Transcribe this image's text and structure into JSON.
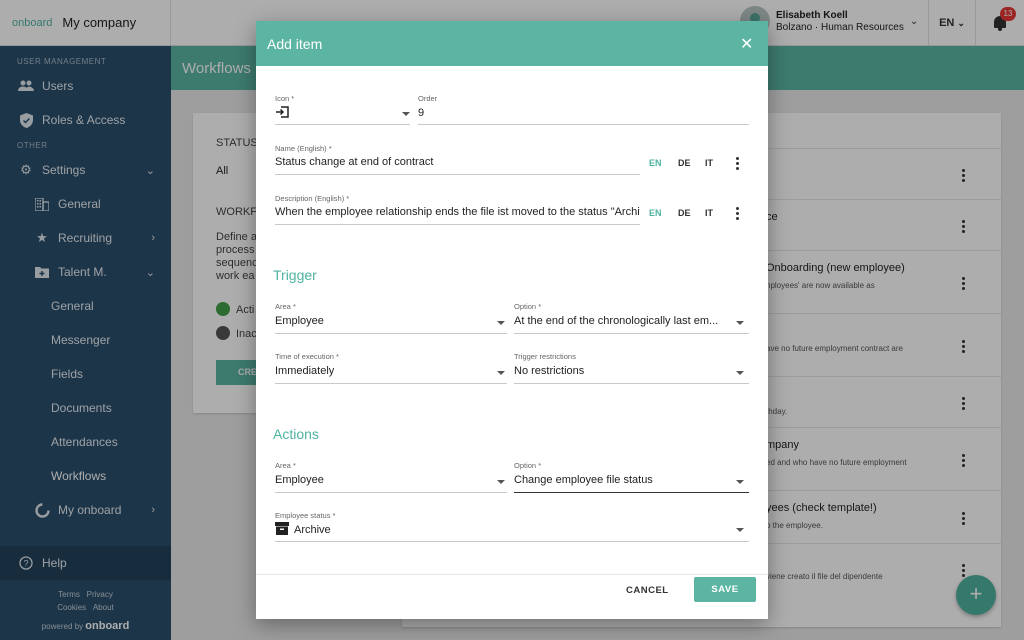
{
  "topbar": {
    "logo": "onboard",
    "company": "My company",
    "user_name": "Elisabeth Koell",
    "user_sub": "Bolzano · Human Resources",
    "lang": "EN",
    "notifications": "13"
  },
  "sidebar": {
    "section_user_management": "USER MANAGEMENT",
    "users": "Users",
    "roles": "Roles & Access",
    "section_other": "OTHER",
    "settings": "Settings",
    "general": "General",
    "recruiting": "Recruiting",
    "talent": "Talent M.",
    "talent_general": "General",
    "messenger": "Messenger",
    "fields": "Fields",
    "documents": "Documents",
    "attendances": "Attendances",
    "workflows": "Workflows",
    "my_onboard": "My onboard",
    "help": "Help",
    "terms": "Terms",
    "privacy": "Privacy",
    "cookies": "Cookies",
    "about": "About",
    "powered_by": "powered by",
    "powered_brand": "onboard"
  },
  "page": {
    "title": "Workflows",
    "status_label": "STATUS",
    "status_value": "All",
    "workflow_label": "WORKFL",
    "define_lines": [
      "Define a",
      "process",
      "sequenc",
      "work ea"
    ],
    "active_label": "Acti",
    "inactive_label": "Inac",
    "create_label": "CRE",
    "rows": [
      {
        "title": "",
        "desc": ""
      },
      {
        "title": "ce",
        "desc": ""
      },
      {
        "title": "Onboarding (new employee)",
        "desc": "nployees' are now available as"
      },
      {
        "title": "",
        "desc": "ave no future employment contract are"
      },
      {
        "title": "",
        "desc": "thday."
      },
      {
        "title": "mpany",
        "desc": "ed and who have no future employment"
      },
      {
        "title": "yees (check template!)",
        "desc": "o the employee."
      },
      {
        "title": "",
        "desc": "viene creato il file del dipendente"
      }
    ]
  },
  "dialog": {
    "title": "Add item",
    "icon_label": "Icon",
    "order_label": "Order",
    "order_value": "9",
    "name_label": "Name (English)",
    "name_value": "Status change at end of contract",
    "desc_label": "Description (English)",
    "desc_value": "When the employee relationship ends the file ist moved to the status \"Archive\"",
    "lang_en": "EN",
    "lang_de": "DE",
    "lang_it": "IT",
    "trigger_title": "Trigger",
    "trigger_area_label": "Area",
    "trigger_area_value": "Employee",
    "trigger_option_label": "Option",
    "trigger_option_value": "At the end of the chronologically last em...",
    "time_label": "Time of execution",
    "time_value": "Immediately",
    "restrictions_label": "Trigger restrictions",
    "restrictions_value": "No restrictions",
    "actions_title": "Actions",
    "action_area_label": "Area",
    "action_area_value": "Employee",
    "action_option_label": "Option",
    "action_option_value": "Change employee file status",
    "emp_status_label": "Employee status",
    "emp_status_value": "Archive",
    "cancel": "CANCEL",
    "save": "SAVE",
    "required": "*"
  },
  "colors": {
    "teal": "#5bb5a2",
    "sidebar": "#2c4f6b",
    "badge": "#e53935"
  }
}
